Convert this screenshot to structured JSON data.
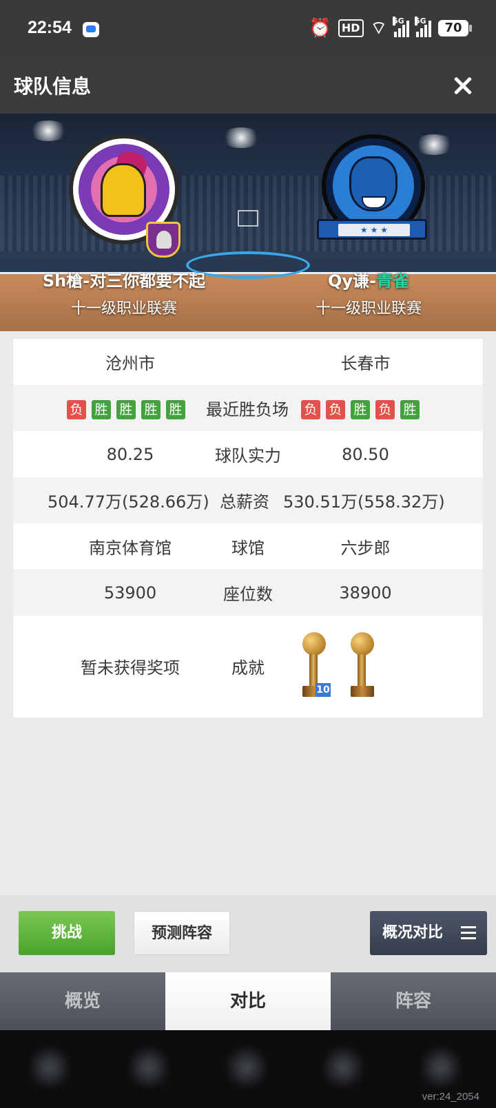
{
  "status_bar": {
    "time": "22:54",
    "hd_label": "HD",
    "network_label_1": "5G",
    "network_label_2": "5G",
    "battery": "70",
    "icons": [
      "chat-app-icon",
      "alarm-icon",
      "hd-icon",
      "wifi-icon",
      "signal-icon",
      "signal-icon",
      "battery-icon"
    ]
  },
  "header": {
    "title": "球队信息",
    "close_icon": "close-icon"
  },
  "teams": {
    "left": {
      "name": "Sh槍-对三你都要不起",
      "league": "十一级职业联赛",
      "city": "沧州市",
      "recent": [
        {
          "label": "负",
          "result": "lose"
        },
        {
          "label": "胜",
          "result": "win"
        },
        {
          "label": "胜",
          "result": "win"
        },
        {
          "label": "胜",
          "result": "win"
        },
        {
          "label": "胜",
          "result": "win"
        }
      ],
      "strength": "80.25",
      "salary": "504.77万(528.66万)",
      "arena": "南京体育馆",
      "seats": "53900",
      "achievement": "暂未获得奖项"
    },
    "right": {
      "name_prefix": "Qy谦-",
      "name_accent": "青雀",
      "league": "十一级职业联赛",
      "city": "长春市",
      "recent": [
        {
          "label": "负",
          "result": "lose"
        },
        {
          "label": "负",
          "result": "lose"
        },
        {
          "label": "胜",
          "result": "win"
        },
        {
          "label": "负",
          "result": "lose"
        },
        {
          "label": "胜",
          "result": "win"
        }
      ],
      "strength": "80.50",
      "salary": "530.51万(558.32万)",
      "arena": "六步郎",
      "seats": "38900",
      "trophy_count": "10"
    }
  },
  "labels": {
    "recent": "最近胜负场",
    "strength": "球队实力",
    "salary": "总薪资",
    "arena": "球馆",
    "seats": "座位数",
    "achievement": "成就"
  },
  "actions": {
    "challenge": "挑战",
    "predict": "预测阵容",
    "overview_compare": "概况对比"
  },
  "tabs": [
    {
      "label": "概览",
      "active": false
    },
    {
      "label": "对比",
      "active": true
    },
    {
      "label": "阵容",
      "active": false
    }
  ],
  "footer": {
    "version": "ver:24_2054"
  },
  "colors": {
    "win": "#43a23d",
    "lose": "#e2524a",
    "accent_name": "#2fd1a3",
    "challenge_button": "#5fb53f"
  }
}
